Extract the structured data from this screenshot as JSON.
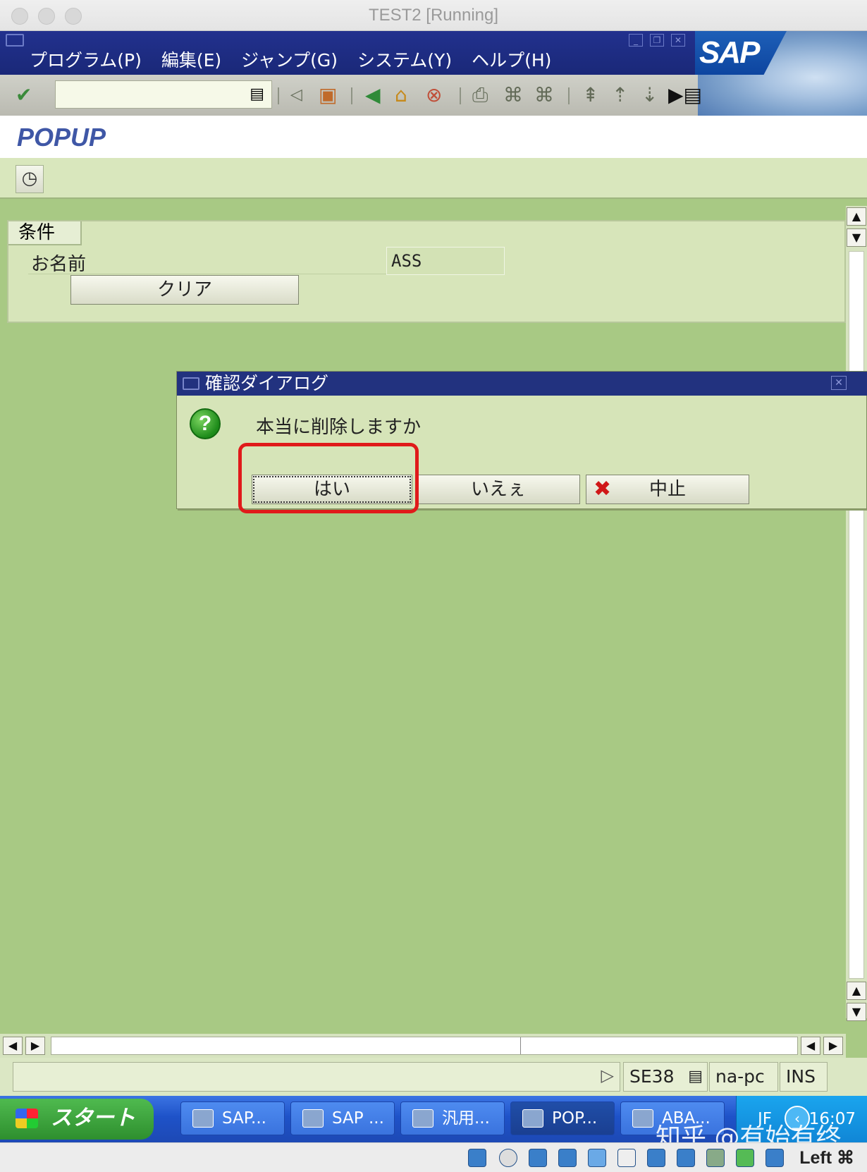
{
  "window": {
    "title": "TEST2 [Running]"
  },
  "menubar": {
    "items": [
      "プログラム(P)",
      "編集(E)",
      "ジャンプ(G)",
      "システム(Y)",
      "ヘルプ(H)"
    ]
  },
  "logo": {
    "text": "SAP"
  },
  "toolbar": {
    "command_value": ""
  },
  "screen": {
    "title": "POPUP"
  },
  "group": {
    "title": "条件",
    "name_label": "お名前",
    "name_value": "ASS",
    "clear_label": "クリア"
  },
  "dialog": {
    "title": "確認ダイアログ",
    "message": "本当に削除しますか",
    "yes_label": "はい",
    "no_label": "いえぇ",
    "cancel_label": "中止"
  },
  "status": {
    "transaction": "SE38",
    "host": "na-pc",
    "mode": "INS"
  },
  "taskbar": {
    "start_label": "スタート",
    "tasks": [
      "SAP...",
      "SAP ...",
      "汎用...",
      "POP...",
      "ABA..."
    ],
    "ime": "JF",
    "clock": "16:07"
  },
  "watermark": "知乎 @有始有终",
  "vbox": {
    "host_key": "Left ⌘"
  },
  "colors": {
    "menubar": "#1a2878",
    "background": "#a8c984",
    "highlight": "#e01a1a",
    "taskbar": "#1e52c8"
  }
}
